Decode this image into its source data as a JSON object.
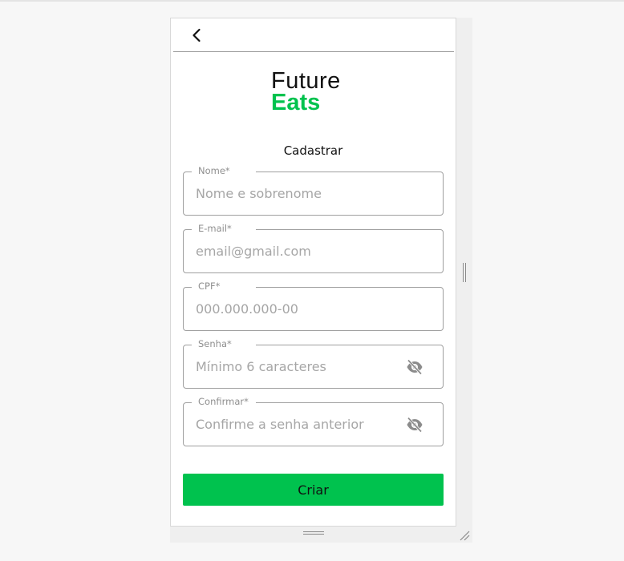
{
  "header": {
    "back_icon": "chevron-left-icon"
  },
  "logo": {
    "line1": "Future",
    "line2": "Eats",
    "accent_color": "#00c24e"
  },
  "title": "Cadastrar",
  "fields": [
    {
      "label": "Nome*",
      "placeholder": "Nome e sobrenome",
      "value": ""
    },
    {
      "label": "E-mail*",
      "placeholder": "email@gmail.com",
      "value": ""
    },
    {
      "label": "CPF*",
      "placeholder": "000.000.000-00",
      "value": ""
    },
    {
      "label": "Senha*",
      "placeholder": "Mínimo 6 caracteres",
      "value": "",
      "icon": "eye-off-icon"
    },
    {
      "label": "Confirmar*",
      "placeholder": "Confirme a senha anterior",
      "value": "",
      "icon": "eye-off-icon"
    }
  ],
  "submit": {
    "label": "Criar",
    "color": "#00c24e"
  }
}
